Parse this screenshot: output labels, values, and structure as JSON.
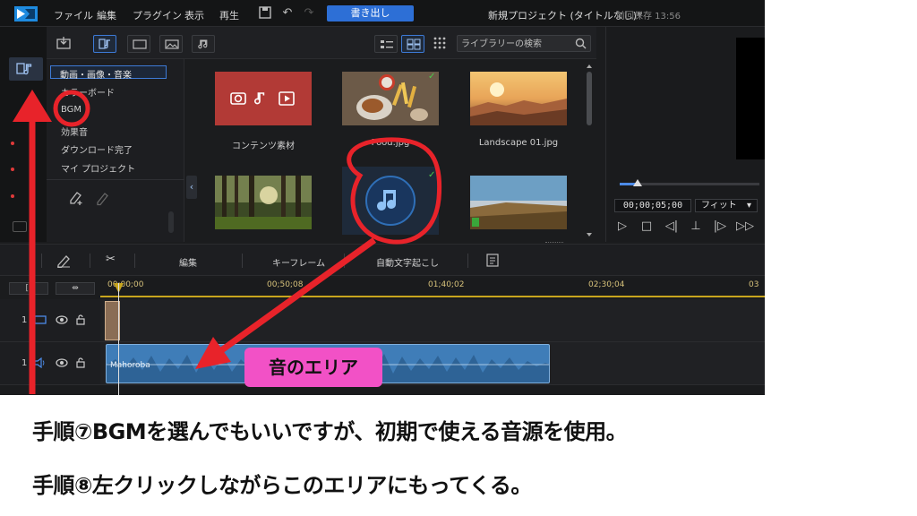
{
  "menu": {
    "items": [
      "ファイル",
      "編集",
      "プラグイン",
      "表示",
      "再生"
    ],
    "export_label": "書き出し",
    "project_title": "新規プロジェクト (タイトルなし)*",
    "saved_info": "前回保存 13:56"
  },
  "library": {
    "search_placeholder": "ライブラリーの検索",
    "categories": [
      "動画・画像・音楽",
      "カラーボード",
      "BGM",
      "効果音",
      "ダウンロード完了",
      "マイ プロジェクト"
    ],
    "items": [
      {
        "label": "コンテンツ素材",
        "icon": "media-content-icon"
      },
      {
        "label": "Food.jpg",
        "icon": "image-thumbnail",
        "checked": true
      },
      {
        "label": "Landscape 01.jpg",
        "icon": "image-thumbnail"
      },
      {
        "label": "",
        "icon": "forest-thumbnail"
      },
      {
        "label": "",
        "icon": "music-note-icon",
        "checked": true
      },
      {
        "label": "",
        "icon": "landscape-thumbnail"
      }
    ]
  },
  "preview": {
    "timecode": "00;00;05;00",
    "fit_option": "フィット"
  },
  "timeline": {
    "tools": [
      "編集",
      "キーフレーム",
      "自動文字起こし"
    ],
    "ruler_labels": [
      "00;00;00",
      "00;50;08",
      "01;40;02",
      "02;30;04",
      "03"
    ],
    "track_numbers": [
      "1",
      "1"
    ],
    "audio_clip_name": "Mahoroba"
  },
  "annotations": {
    "area_label": "音のエリア",
    "caption_1": "手順⑦BGMを選んでもいいですが、初期で使える音源を使用。",
    "caption_2": "手順⑧左クリックしながらこのエリアにもってくる。",
    "accent_color": "#e8232a",
    "label_color": "#f251c6"
  }
}
